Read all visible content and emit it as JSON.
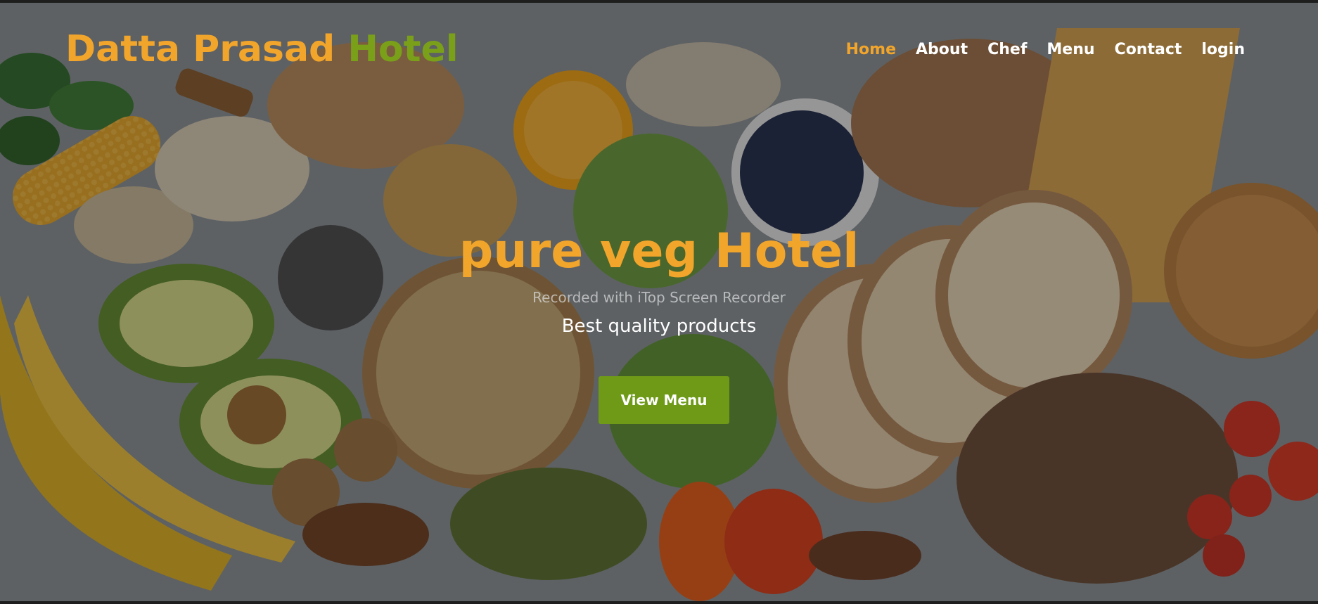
{
  "brand": {
    "part1": "Datta Prasad",
    "part2": "Hotel",
    "color1": "#f2a52b",
    "color2": "#7aa01a"
  },
  "nav": {
    "items": [
      {
        "label": "Home",
        "active": true
      },
      {
        "label": "About",
        "active": false
      },
      {
        "label": "Chef",
        "active": false
      },
      {
        "label": "Menu",
        "active": false
      },
      {
        "label": "Contact",
        "active": false
      },
      {
        "label": "login",
        "active": false
      }
    ],
    "active_color": "#f2a52b"
  },
  "hero": {
    "title": "pure veg Hotel",
    "watermark": "Recorded with iTop Screen Recorder",
    "tagline": "Best quality products",
    "cta_label": "View Menu",
    "cta_color": "#6e9a17",
    "background": "healthy-food-flatlay-image"
  }
}
